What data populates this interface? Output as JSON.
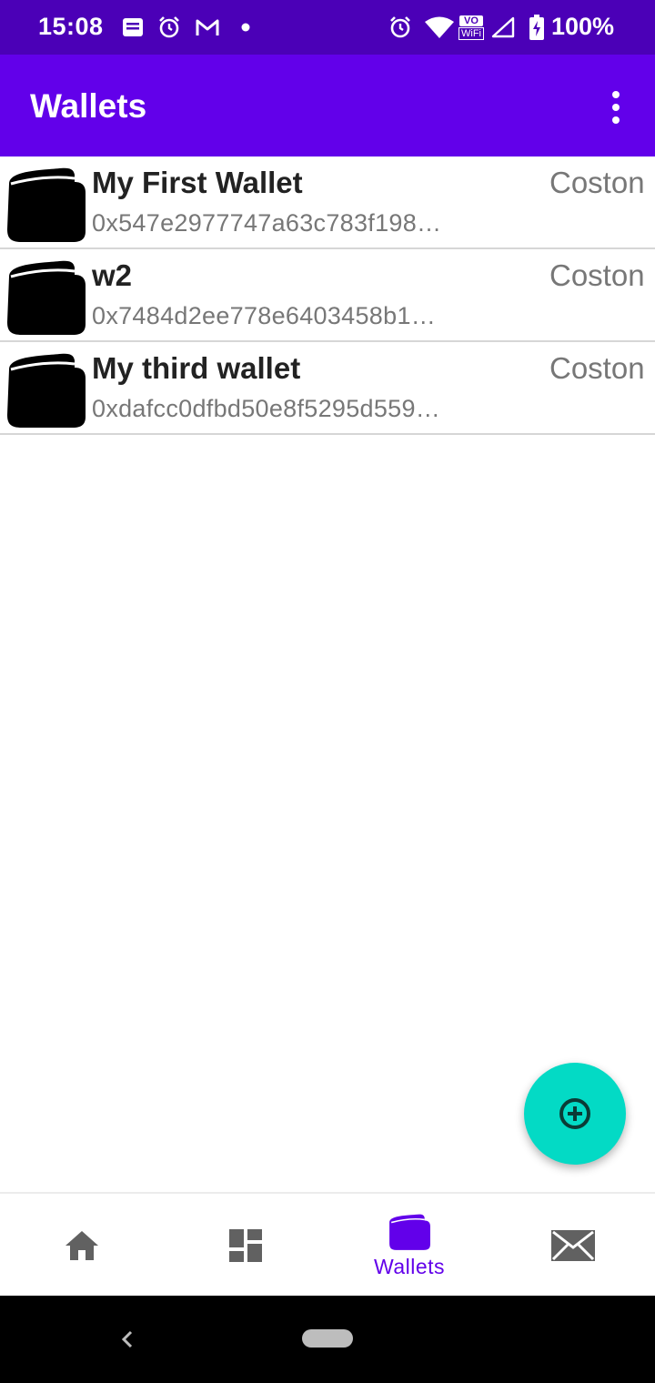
{
  "status_bar": {
    "time": "15:08",
    "battery": "100%",
    "left_icons": [
      "message-icon",
      "alarm-icon",
      "gmail-icon",
      "dot-icon"
    ],
    "right_icons": [
      "alarm-icon",
      "wifi-icon",
      "vowifi-icon",
      "signal-icon",
      "battery-icon"
    ],
    "vowifi_top": "VO",
    "vowifi_bottom": "WiFi"
  },
  "app_bar": {
    "title": "Wallets",
    "menu_icon": "more-vert-icon"
  },
  "wallets": [
    {
      "name": "My First Wallet",
      "address": "0x547e2977747a63c783f198…",
      "network": "Coston"
    },
    {
      "name": "w2",
      "address": "0x7484d2ee778e6403458b1…",
      "network": "Coston"
    },
    {
      "name": "My third wallet",
      "address": "0xdafcc0dfbd50e8f5295d559…",
      "network": "Coston"
    }
  ],
  "fab": {
    "icon": "add-circle-icon"
  },
  "bottom_nav": {
    "items": [
      {
        "icon": "home-icon",
        "label": ""
      },
      {
        "icon": "dashboard-icon",
        "label": ""
      },
      {
        "icon": "wallet-icon",
        "label": "Wallets",
        "selected": true
      },
      {
        "icon": "mail-icon",
        "label": ""
      }
    ]
  },
  "colors": {
    "status_bar": "#4b00b7",
    "app_bar": "#6200ea",
    "fab": "#03dac5",
    "accent": "#6200ea",
    "inactive_icon": "#616161"
  }
}
